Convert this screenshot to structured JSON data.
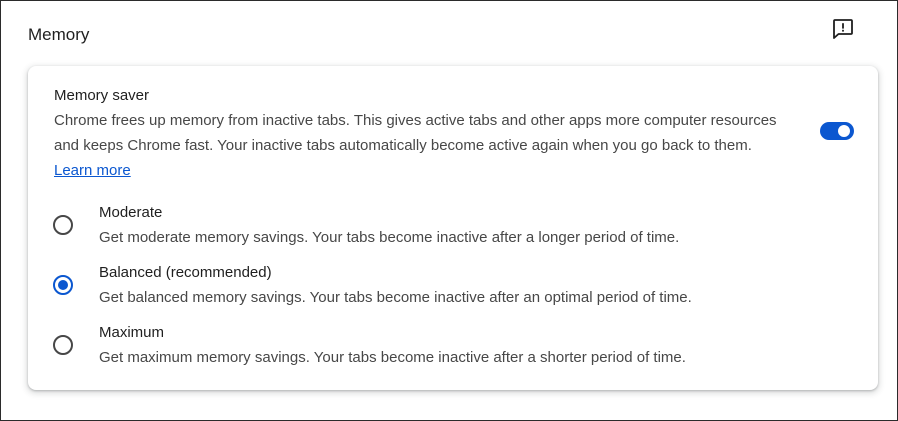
{
  "section": {
    "title": "Memory",
    "feedback_icon": "feedback-icon"
  },
  "memory_saver": {
    "title": "Memory saver",
    "description": "Chrome frees up memory from inactive tabs. This gives active tabs and other apps more computer resources and keeps Chrome fast. Your inactive tabs automatically become active again when you go back to them.",
    "learn_more": "Learn more",
    "toggle_on": true
  },
  "options": [
    {
      "label": "Moderate",
      "description": "Get moderate memory savings. Your tabs become inactive after a longer period of time.",
      "selected": false
    },
    {
      "label": "Balanced (recommended)",
      "description": "Get balanced memory savings. Your tabs become inactive after an optimal period of time.",
      "selected": true
    },
    {
      "label": "Maximum",
      "description": "Get maximum memory savings. Your tabs become inactive after a shorter period of time.",
      "selected": false
    }
  ],
  "colors": {
    "accent": "#0b57d0",
    "text_primary": "#1f1f1f",
    "text_secondary": "#474747"
  }
}
